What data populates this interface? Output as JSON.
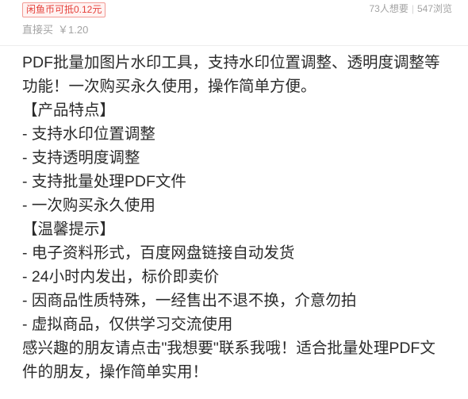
{
  "listing": {
    "coin_badge": "闲鱼币可抵0.12元",
    "want_count": "73人想要",
    "stats_separator": "|",
    "view_count": "547浏览",
    "buy_label": "直接买",
    "price": "￥1.20"
  },
  "description": {
    "lines": [
      "PDF批量加图片水印工具，支持水印位置调整、透明度调整等",
      "功能！一次购买永久使用，操作简单方便。",
      "【产品特点】",
      "- 支持水印位置调整",
      "- 支持透明度调整",
      "- 支持批量处理PDF文件",
      "- 一次购买永久使用",
      "【温馨提示】",
      "- 电子资料形式，百度网盘链接自动发货",
      "- 24小时内发出，标价即卖价",
      "- 因商品性质特殊，一经售出不退不换，介意勿拍",
      "- 虚拟商品，仅供学习交流使用",
      "感兴趣的朋友请点击\"我想要\"联系我哦！适合批量处理PDF文",
      "件的朋友，操作简单实用！"
    ]
  },
  "colors": {
    "accent": "#e5403a",
    "accent_border": "#f19a94",
    "accent_bg": "#fff3f2",
    "muted_text": "#a3a3a3",
    "separator": "#d6d6d6",
    "body_text": "#2b2b2b",
    "divider": "#ededed",
    "page_bg": "#ffffff"
  }
}
